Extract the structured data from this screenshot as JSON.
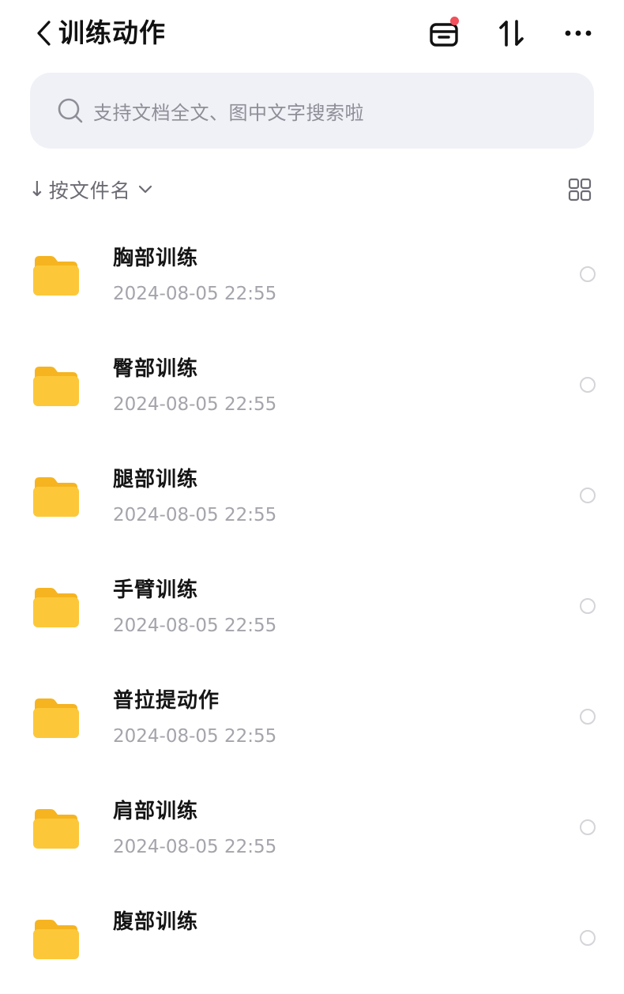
{
  "header": {
    "title": "训练动作",
    "back_icon": "chevron-left-icon",
    "inbox_icon": "inbox-tray-icon",
    "sort_icon": "sort-arrows-icon",
    "more_icon": "more-dots-icon",
    "notification_dot_color": "#f2505a"
  },
  "search": {
    "placeholder": "支持文档全文、图中文字搜索啦",
    "icon": "search-icon"
  },
  "sort": {
    "arrow": "↓",
    "label": "按文件名",
    "chevron_icon": "chevron-down-icon",
    "view_toggle_icon": "grid-view-icon"
  },
  "files": [
    {
      "name": "胸部训练",
      "date": "2024-08-05 22:55"
    },
    {
      "name": "臀部训练",
      "date": "2024-08-05 22:55"
    },
    {
      "name": "腿部训练",
      "date": "2024-08-05 22:55"
    },
    {
      "name": "手臂训练",
      "date": "2024-08-05 22:55"
    },
    {
      "name": "普拉提动作",
      "date": "2024-08-05 22:55"
    },
    {
      "name": "肩部训练",
      "date": "2024-08-05 22:55"
    },
    {
      "name": "腹部训练",
      "date": ""
    }
  ],
  "colors": {
    "folder": "#fcc83a",
    "folder_tab": "#f5b420",
    "search_bg": "#f0f1f7"
  }
}
